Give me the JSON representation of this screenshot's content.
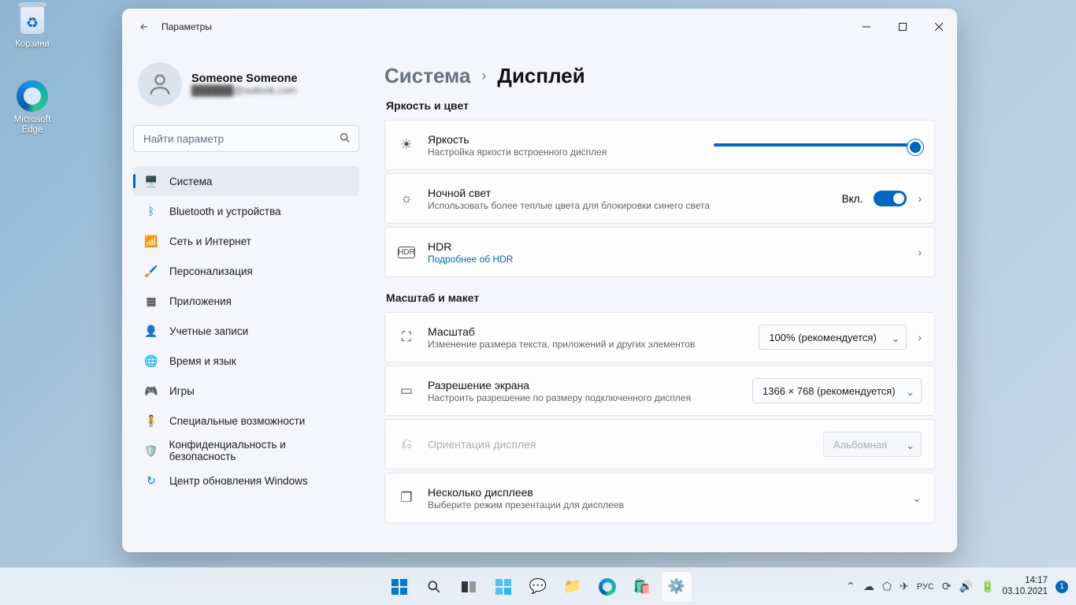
{
  "desktop": {
    "icons": [
      {
        "label": "Корзина"
      },
      {
        "label": "Microsoft Edge"
      }
    ]
  },
  "window": {
    "app_title": "Параметры",
    "profile": {
      "name": "Someone Someone",
      "email": "██████@outlook.com"
    },
    "search": {
      "placeholder": "Найти параметр"
    },
    "nav": [
      {
        "label": "Система",
        "color": "#0067c0"
      },
      {
        "label": "Bluetooth и устройства",
        "color": "#0078d4"
      },
      {
        "label": "Сеть и Интернет",
        "color": "#0099e5"
      },
      {
        "label": "Персонализация",
        "color": "#c65d21"
      },
      {
        "label": "Приложения",
        "color": "#4a6fa5"
      },
      {
        "label": "Учетные записи",
        "color": "#2b9e6f"
      },
      {
        "label": "Время и язык",
        "color": "#5b8cc0"
      },
      {
        "label": "Игры",
        "color": "#6b7280"
      },
      {
        "label": "Специальные возможности",
        "color": "#005fb8"
      },
      {
        "label": "Конфиденциальность и безопасность",
        "color": "#6b7280"
      },
      {
        "label": "Центр обновления Windows",
        "color": "#0078d4"
      }
    ],
    "breadcrumb": {
      "parent": "Система",
      "current": "Дисплей"
    },
    "sections": {
      "brightness_color": {
        "title": "Яркость и цвет",
        "brightness": {
          "title": "Яркость",
          "desc": "Настройка яркости встроенного дисплея",
          "value": 100
        },
        "night_light": {
          "title": "Ночной свет",
          "desc": "Использовать более теплые цвета для блокировки синего света",
          "state_label": "Вкл.",
          "on": true
        },
        "hdr": {
          "title": "HDR",
          "link": "Подробнее об HDR"
        }
      },
      "scale_layout": {
        "title": "Масштаб и макет",
        "scale": {
          "title": "Масштаб",
          "desc": "Изменение размера текста, приложений и других элементов",
          "value": "100% (рекомендуется)"
        },
        "resolution": {
          "title": "Разрешение экрана",
          "desc": "Настроить разрешение по размеру подключенного дисплея",
          "value": "1366 × 768 (рекомендуется)"
        },
        "orientation": {
          "title": "Ориентация дисплея",
          "value": "Альбомная",
          "disabled": true
        },
        "multi": {
          "title": "Несколько дисплеев",
          "desc": "Выберите режим презентации для дисплеев"
        }
      }
    }
  },
  "taskbar": {
    "lang": "РУС",
    "time": "14:17",
    "date": "03.10.2021",
    "badge": "1"
  }
}
